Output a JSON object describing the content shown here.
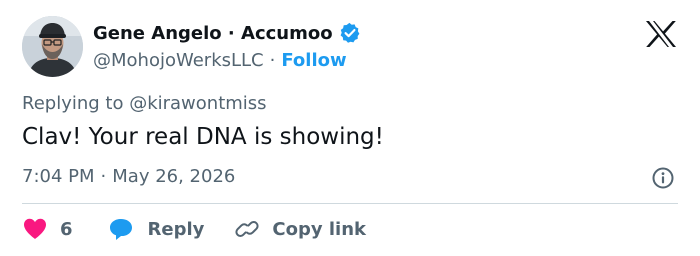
{
  "author": {
    "display_name": "Gene Angelo · Accumoo",
    "handle": "@MohojoWerksLLC",
    "separator": "·",
    "follow_label": "Follow",
    "verified_badge_icon": "verified-badge-icon",
    "avatar_icon": "avatar"
  },
  "brand": {
    "logo_icon": "x-logo-icon"
  },
  "tweet": {
    "replying_to": "Replying to @kirawontmiss",
    "text": "Clav! Your real DNA is showing!",
    "time": "7:04 PM",
    "date": "May 26, 2026",
    "meta_separator": "·",
    "info_icon": "info-icon"
  },
  "actions": {
    "like_icon": "heart-icon",
    "like_count": "6",
    "reply_icon": "speech-bubble-icon",
    "reply_label": "Reply",
    "copy_icon": "link-icon",
    "copy_label": "Copy link"
  },
  "colors": {
    "accent": "#1d9bf0",
    "like": "#f91880",
    "text_primary": "#0f1419",
    "text_secondary": "#536471",
    "divider": "#cfd9de"
  }
}
